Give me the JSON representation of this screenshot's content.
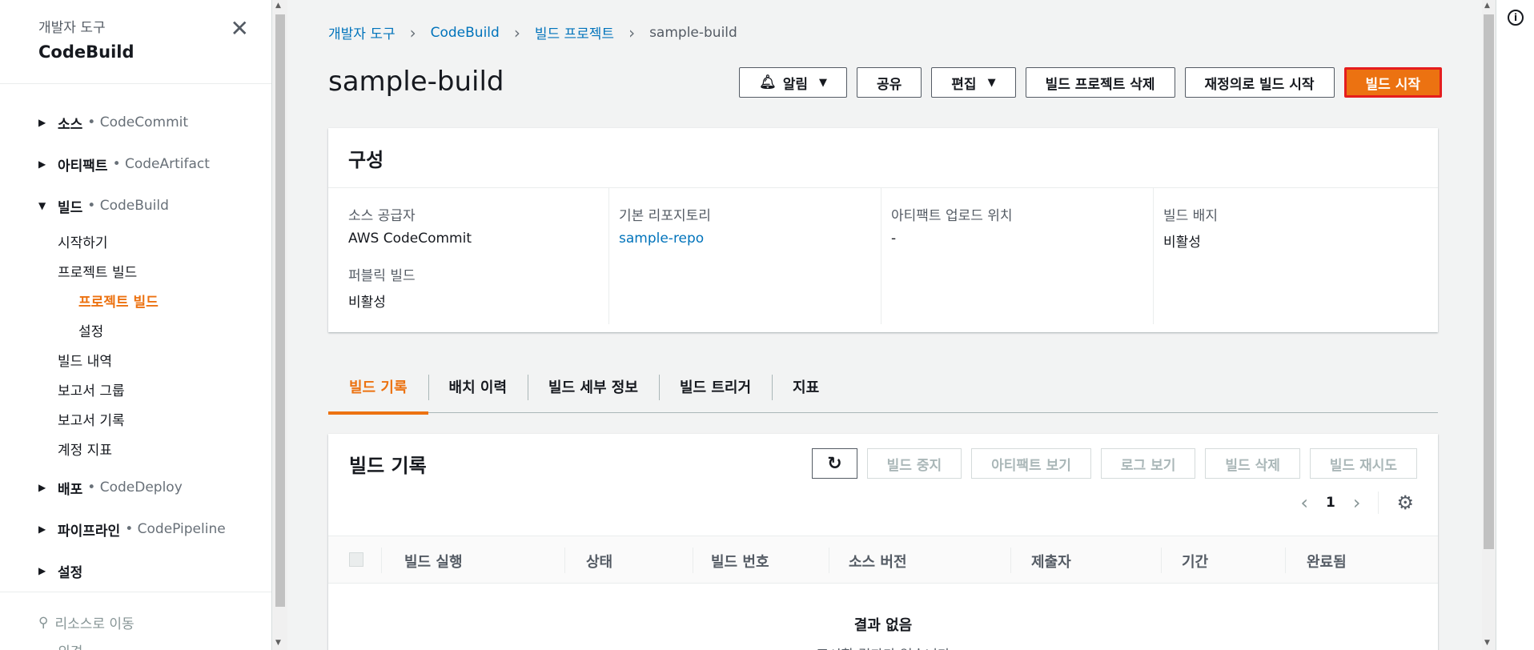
{
  "sidebar": {
    "subtitle": "개발자 도구",
    "title": "CodeBuild",
    "groups": [
      {
        "label": "소스",
        "service": "• CodeCommit"
      },
      {
        "label": "아티팩트",
        "service": "• CodeArtifact"
      },
      {
        "label": "빌드",
        "service": "• CodeBuild"
      },
      {
        "label": "배포",
        "service": "• CodeDeploy"
      },
      {
        "label": "파이프라인",
        "service": "• CodePipeline"
      },
      {
        "label": "설정",
        "service": ""
      }
    ],
    "build_items": [
      "시작하기",
      "프로젝트 빌드",
      "프로젝트 빌드",
      "설정",
      "빌드 내역",
      "보고서 그룹",
      "보고서 기록",
      "계정 지표"
    ],
    "footer_search": "리소스로 이동",
    "footer_feedback": "의견"
  },
  "breadcrumb": [
    "개발자 도구",
    "CodeBuild",
    "빌드 프로젝트",
    "sample-build"
  ],
  "page_title": "sample-build",
  "actions": {
    "notify": "알림",
    "share": "공유",
    "edit": "편집",
    "delete_project": "빌드 프로젝트 삭제",
    "start_override": "재정의로 빌드 시작",
    "start_build": "빌드 시작"
  },
  "config": {
    "title": "구성",
    "source_provider_label": "소스 공급자",
    "source_provider_value": "AWS CodeCommit",
    "public_build_label": "퍼블릭 빌드",
    "public_build_value": "비활성",
    "primary_repo_label": "기본 리포지토리",
    "primary_repo_value": "sample-repo",
    "artifact_loc_label": "아티팩트 업로드 위치",
    "artifact_loc_value": "-",
    "badge_label": "빌드 배지",
    "badge_value": "비활성"
  },
  "tabs": [
    "빌드 기록",
    "배치 이력",
    "빌드 세부 정보",
    "빌드 트리거",
    "지표"
  ],
  "history": {
    "title": "빌드 기록",
    "refresh_icon": "↻",
    "buttons": [
      "빌드 중지",
      "아티팩트 보기",
      "로그 보기",
      "빌드 삭제",
      "빌드 재시도"
    ],
    "page": "1",
    "columns": [
      "빌드 실행",
      "상태",
      "빌드 번호",
      "소스 버전",
      "제출자",
      "기간",
      "완료됨"
    ],
    "empty_title": "결과 없음",
    "empty_desc": "표시할 결과가 없습니다"
  },
  "colors": {
    "accent": "#ec7211",
    "link": "#0073bb",
    "highlight_border": "#e51d1d"
  }
}
